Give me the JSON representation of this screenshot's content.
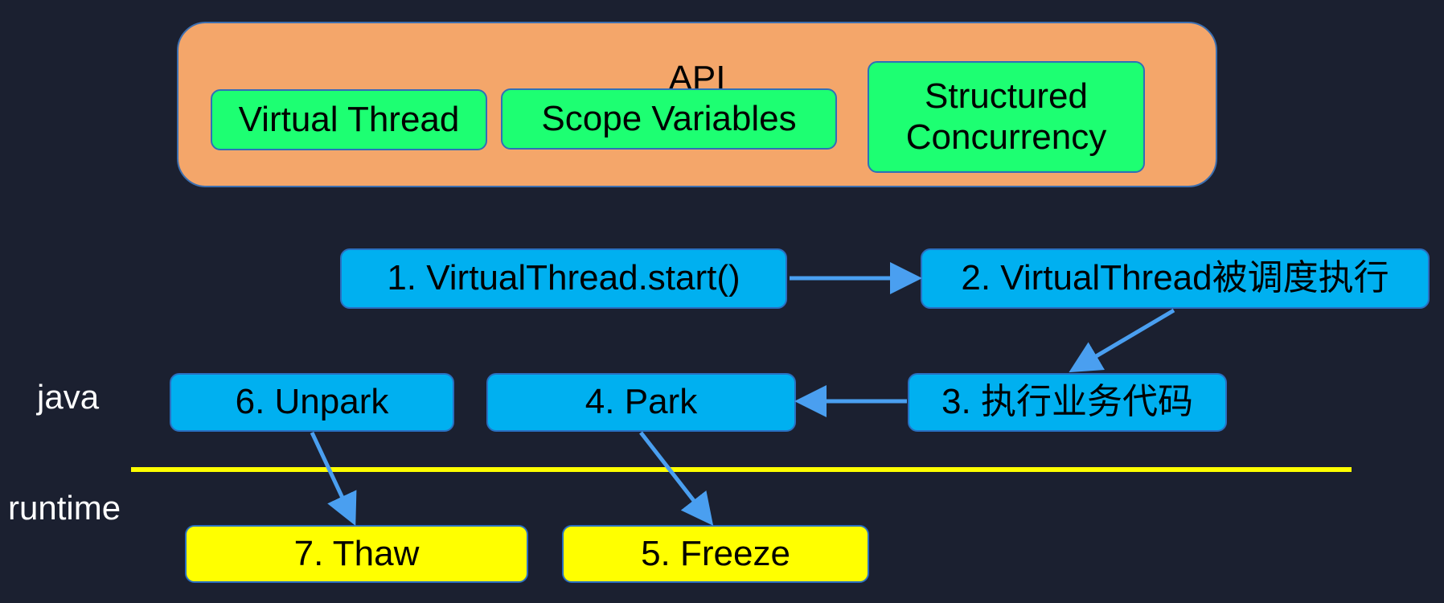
{
  "api": {
    "title": "API",
    "items": [
      "Virtual Thread",
      "Scope Variables",
      "Structured Concurrency"
    ]
  },
  "steps": {
    "s1": "1. VirtualThread.start()",
    "s2": "2. VirtualThread被调度执行",
    "s3": "3. 执行业务代码",
    "s4": "4. Park",
    "s5": "5. Freeze",
    "s6": "6. Unpark",
    "s7": "7. Thaw"
  },
  "layers": {
    "java": "java",
    "runtime": "runtime"
  },
  "colors": {
    "background": "#1b2030",
    "api": "#f4a66a",
    "api_item": "#1dff72",
    "java_step": "#00b0f0",
    "runtime_step": "#ffff00",
    "arrow": "#4a9ff0",
    "divider": "#ffff00"
  }
}
